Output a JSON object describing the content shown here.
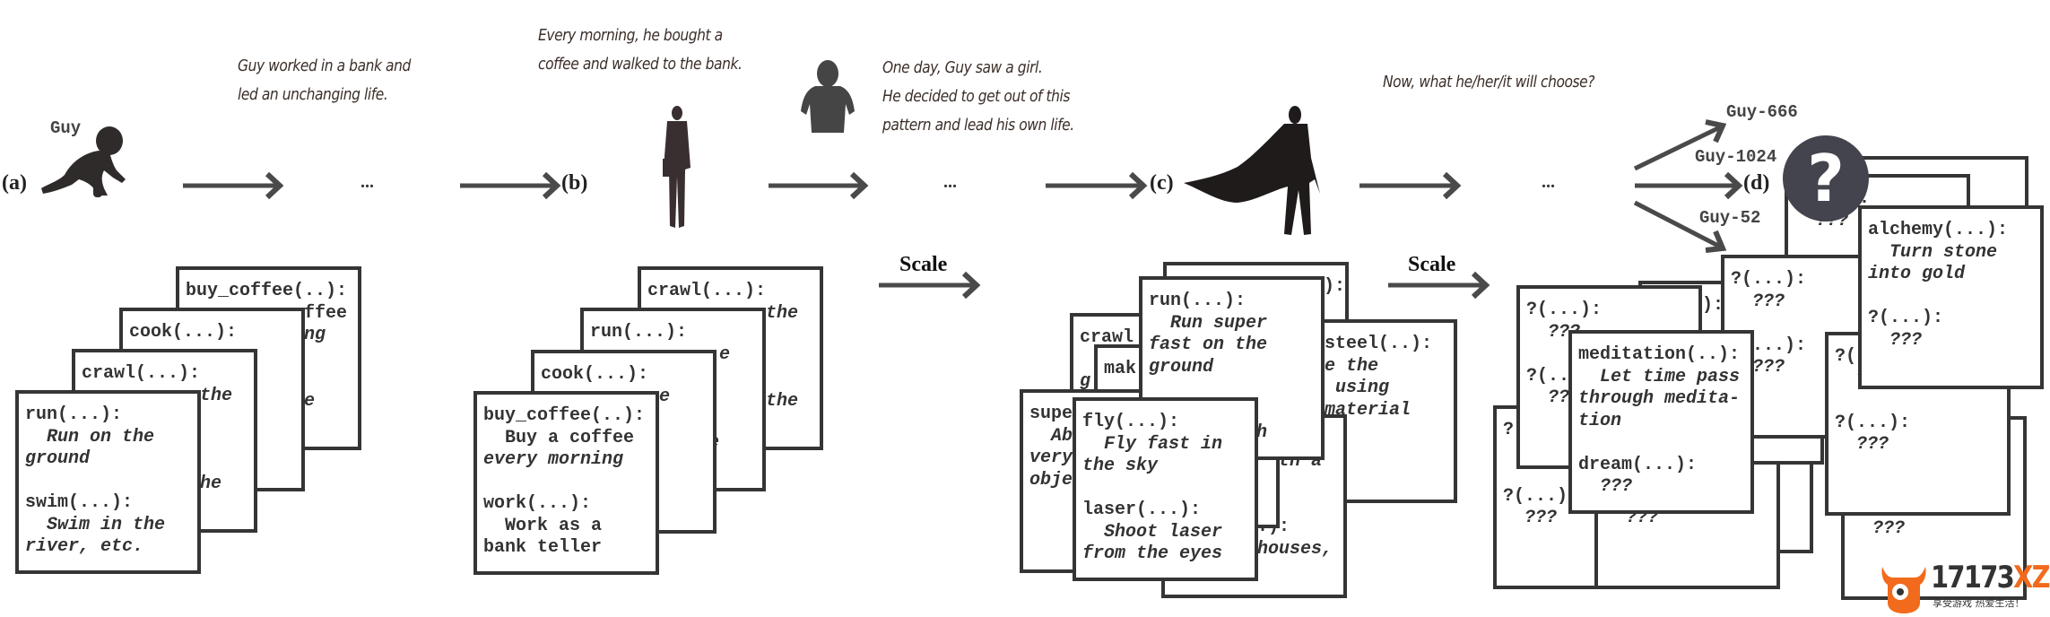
{
  "narrative": {
    "guy_label": "Guy",
    "text1": "Guy worked in a bank and\nled an unchanging life.",
    "text2": "Every morning, he bought a\ncoffee and walked to the bank.",
    "text3": "One day, Guy saw a girl.\nHe decided to get out of this\npattern and lead his own life.",
    "text4": "Now, what he/her/it will choose?"
  },
  "stages": {
    "a": "(a)",
    "b": "(b)",
    "c": "(c)",
    "d": "(d)"
  },
  "ellipsis": "...",
  "scale_label": "Scale",
  "branches": [
    "Guy-666",
    "Guy-1024",
    "Guy-52"
  ],
  "question_mark": "?",
  "colors": {
    "ink": "#333333",
    "arrow": "#4a4a4a",
    "question_circle": "#43444e",
    "logo_orange": "#f26a1b"
  },
  "stage_a": {
    "cards": [
      {
        "lines": [
          {
            "t": "buy_coffee(..):"
          },
          {
            "t": "           ffee"
          },
          {
            "t": "           ng",
            "i": true
          },
          {
            "t": ""
          },
          {
            "t": ""
          },
          {
            "t": "           e",
            "i": true
          }
        ]
      },
      {
        "lines": [
          {
            "t": "cook(...):"
          }
        ]
      },
      {
        "lines": [
          {
            "t": "crawl(...):"
          },
          {
            "t": "           the",
            "i": true
          },
          {
            "t": ""
          },
          {
            "t": ""
          },
          {
            "t": ""
          },
          {
            "t": "           he",
            "i": true
          }
        ]
      },
      {
        "lines": [
          {
            "t": "run(...):"
          },
          {
            "t": "  Run on the",
            "i": true
          },
          {
            "t": "ground",
            "i": true
          },
          {
            "t": ""
          },
          {
            "t": "swim(...):"
          },
          {
            "t": "  Swim in the",
            "i": true
          },
          {
            "t": "river, etc.",
            "i": true
          }
        ]
      }
    ]
  },
  "stage_b": {
    "cards": [
      {
        "lines": [
          {
            "t": "crawl(...):"
          },
          {
            "t": "           the",
            "i": true
          },
          {
            "t": ""
          },
          {
            "t": ""
          },
          {
            "t": ""
          },
          {
            "t": "           the",
            "i": true
          }
        ]
      },
      {
        "lines": [
          {
            "t": "run(...):"
          },
          {
            "t": "            e",
            "i": true
          },
          {
            "t": ""
          },
          {
            "t": ""
          },
          {
            "t": ""
          },
          {
            "t": "          he",
            "i": true
          }
        ]
      },
      {
        "lines": [
          {
            "t": "cook(...):"
          },
          {
            "t": "           e",
            "i": true
          }
        ]
      },
      {
        "lines": [
          {
            "t": "buy_coffee(..):"
          },
          {
            "t": "  Buy a coffee"
          },
          {
            "t": "every morning",
            "i": true
          },
          {
            "t": ""
          },
          {
            "t": "work(...):"
          },
          {
            "t": "  Work as a"
          },
          {
            "t": "bank teller"
          }
        ]
      }
    ]
  },
  "stage_c": {
    "cards": [
      {
        "lines": [
          {
            "t": "              ):"
          }
        ]
      },
      {
        "lines": [
          {
            "t": "    steel(..):"
          },
          {
            "t": "    e the",
            "i": true
          },
          {
            "t": "     using",
            "i": true
          },
          {
            "t": "    material",
            "i": true
          }
        ]
      },
      {
        "lines": [
          {
            "t": ""
          },
          {
            "t": "        with a",
            "i": true
          },
          {
            "t": ""
          },
          {
            "t": ""
          },
          {
            "t": "        .):"
          },
          {
            "t": "        houses,",
            "i": true
          }
        ]
      },
      {
        "lines": [
          {
            "t": "crawl"
          },
          {
            "t": ""
          },
          {
            "t": "g",
            "i": true
          }
        ]
      },
      {
        "lines": [
          {
            "t": "mak"
          }
        ]
      },
      {
        "lines": [
          {
            "t": "supe"
          },
          {
            "t": "  Ab",
            "i": true
          },
          {
            "t": "very",
            "i": true
          },
          {
            "t": "obje",
            "i": true
          }
        ]
      },
      {
        "lines": [
          {
            "t": "run(...):"
          },
          {
            "t": "  Run super",
            "i": true
          },
          {
            "t": "fast on the",
            "i": true
          },
          {
            "t": "ground",
            "i": true
          },
          {
            "t": ""
          },
          {
            "t": ""
          },
          {
            "t": "          h",
            "i": true
          }
        ]
      },
      {
        "lines": [
          {
            "t": "fly(...):"
          },
          {
            "t": "  Fly fast in",
            "i": true
          },
          {
            "t": "the sky",
            "i": true
          },
          {
            "t": ""
          },
          {
            "t": "laser(...):"
          },
          {
            "t": "  Shoot laser",
            "i": true
          },
          {
            "t": "from the eyes",
            "i": true
          }
        ]
      }
    ]
  },
  "stage_d": {
    "cards": [
      {
        "lines": []
      },
      {
        "lines": [
          {
            "t": "?(...):"
          },
          {
            "t": "  ???",
            "i": true
          }
        ]
      },
      {
        "lines": []
      },
      {
        "lines": [
          {
            "t": "?(...):"
          },
          {
            "t": ""
          },
          {
            "t": ""
          },
          {
            "t": "?(...)"
          },
          {
            "t": "  ???",
            "i": true
          }
        ]
      },
      {
        "lines": [
          {
            "t": ""
          },
          {
            "t": ""
          },
          {
            "t": ""
          },
          {
            "t": ""
          },
          {
            "t": "  ???",
            "i": true
          }
        ]
      },
      {
        "lines": [
          {
            "t": "?(...):"
          }
        ]
      },
      {
        "lines": [
          {
            "t": "?(...):"
          },
          {
            "t": "  ???",
            "i": true
          },
          {
            "t": ""
          },
          {
            "t": "?(...):"
          },
          {
            "t": "  ???",
            "i": true
          }
        ]
      },
      {
        "lines": [
          {
            "t": "?(...):"
          },
          {
            "t": "  ???",
            "i": true
          },
          {
            "t": ""
          },
          {
            "t": "?(...):"
          },
          {
            "t": "  ???",
            "i": true
          }
        ]
      },
      {
        "lines": [
          {
            "t": "meditation(..):"
          },
          {
            "t": "  Let time pass",
            "i": true
          },
          {
            "t": "through medita-",
            "i": true
          },
          {
            "t": "tion",
            "i": true
          },
          {
            "t": ""
          },
          {
            "t": "dream(...):"
          },
          {
            "t": "  ???",
            "i": true
          }
        ]
      },
      {
        "lines": [
          {
            "t": "?(...):"
          },
          {
            "t": "  ???",
            "i": true
          },
          {
            "t": ""
          },
          {
            "t": "?(...):"
          },
          {
            "t": "  ???",
            "i": true
          }
        ]
      },
      {
        "lines": [
          {
            "t": "?(...):"
          },
          {
            "t": "  ???",
            "i": true
          },
          {
            "t": ""
          },
          {
            "t": "?(...):"
          },
          {
            "t": "  ???",
            "i": true
          }
        ]
      },
      {
        "lines": [
          {
            "t": "alchemy(...):"
          },
          {
            "t": "  Turn stone",
            "i": true
          },
          {
            "t": "into gold",
            "i": true
          },
          {
            "t": ""
          },
          {
            "t": "?(...):"
          },
          {
            "t": "  ???",
            "i": true
          }
        ]
      }
    ]
  },
  "watermark": {
    "main": "17173",
    "accent": "XZ",
    "sub": "享受游戏 热爱生活！"
  }
}
